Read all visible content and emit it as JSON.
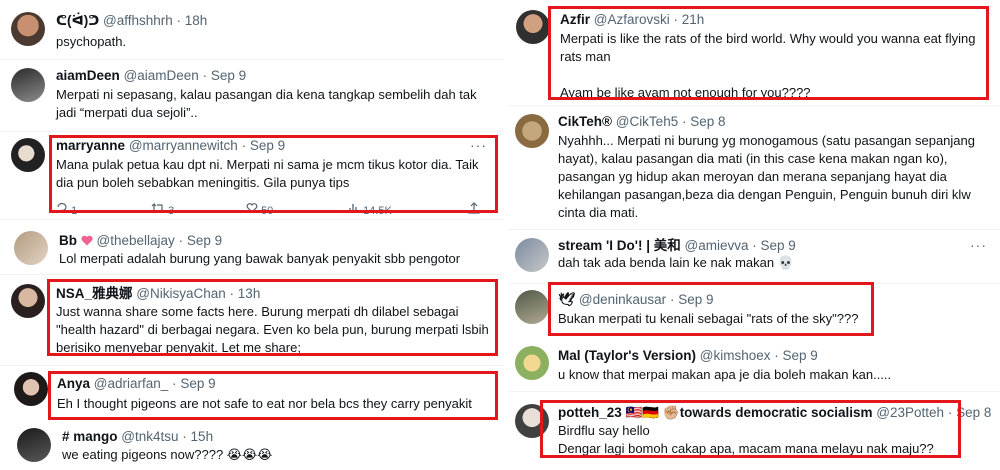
{
  "left": [
    {
      "name": "ᕦ(ᐛ)ᕤ",
      "handle": "@affhshhrh",
      "time": "18h",
      "body": "psychopath."
    },
    {
      "name": "aiamDeen",
      "handle": "@aiamDeen",
      "time": "Sep 9",
      "body": "Merpati ni sepasang, kalau pasangan dia kena tangkap sembelih dah tak\njadi “merpati dua sejoli”.."
    },
    {
      "name": "marryanne",
      "handle": "@marryannewitch",
      "time": "Sep 9",
      "body": "Mana pulak petua kau dpt ni. Merpati ni sama je mcm tikus kotor dia. Taik\ndia pun boleh sebabkan meningitis. Gila punya tips",
      "actions": {
        "replies": "1",
        "retweets": "3",
        "likes": "50",
        "views": "14.5K"
      }
    },
    {
      "name": "Bb",
      "handle": "@thebellajay",
      "time": "Sep 9",
      "body": "Lol merpati adalah burung yang bawak banyak penyakit sbb pengotor"
    },
    {
      "name": "NSA_雅典娜",
      "handle": "@NikisyaChan",
      "time": "13h",
      "body": "Just wanna share some facts here. Burung merpati dh dilabel sebagai\n\"health hazard\" di berbagai negara. Even ko bela pun, burung merpati lsbih\nberisiko menyebar penyakit. Let me share;"
    },
    {
      "name": "Anya",
      "handle": "@adriarfan_",
      "time": "Sep 9",
      "body": "Eh I thought pigeons are not safe to eat nor bela bcs they carry penyakit"
    },
    {
      "name": "# mango",
      "handle": "@tnk4tsu",
      "time": "15h",
      "body": "we eating pigeons now???? 😭😭😭"
    }
  ],
  "right": [
    {
      "name": "Azfir",
      "handle": "@Azfarovski",
      "time": "21h",
      "body": "Merpati is like the rats of the bird world. Why would you wanna eat flying\nrats man\n\nAyam be like ayam not enough for you????"
    },
    {
      "name": "CikTeh®",
      "handle": "@CikTeh5",
      "time": "Sep 8",
      "body": "Nyahhh... Merpati ni burung yg monogamous (satu pasangan sepanjang\nhayat), kalau pasangan dia mati (in this case kena makan ngan ko),\npasangan yg hidup akan meroyan dan merana sepanjang hayat dia\nkehilangan pasangan,beza dia dengan Penguin, Penguin bunuh diri klw\ncinta dia mati."
    },
    {
      "name": "stream 'I Do'! | 美和",
      "handle": "@amievva",
      "time": "Sep 9",
      "body": "dah tak ada benda lain ke nak makan 💀"
    },
    {
      "name": "🕊",
      "handle": "@deninkausar",
      "time": "Sep 9",
      "body": "Bukan merpati tu kenali sebagai \"rats of the sky\"???"
    },
    {
      "name": "Mal (Taylor's Version)",
      "handle": "@kimshoex",
      "time": "Sep 9",
      "body": "u know that merpai makan apa je dia boleh makan kan....."
    },
    {
      "name": "potteh_23 🇲🇾🇩🇪 ✊🏼towards democratic socialism",
      "handle": "@23Potteh",
      "time": "Sep 8",
      "body": "Birdflu say hello\nDengar lagi bomoh cakap apa, macam mana melayu nak maju??"
    }
  ],
  "ui": {
    "more": "···",
    "dot": "·"
  },
  "colors": {
    "highlight_box": "#e3161c",
    "secondary_text": "#536471",
    "primary_text": "#0f1419"
  }
}
